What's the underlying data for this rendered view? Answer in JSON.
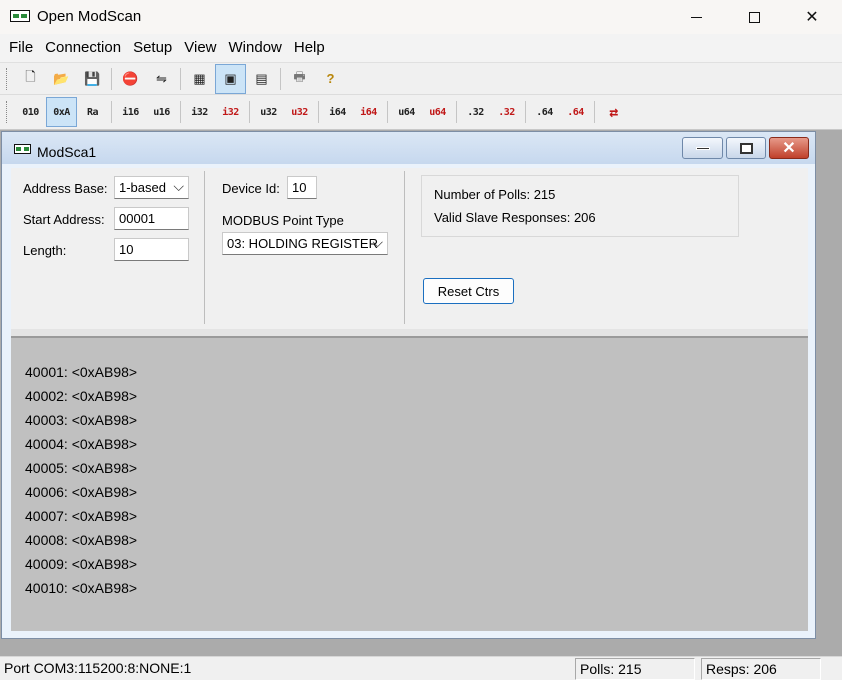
{
  "window": {
    "title": "Open ModScan"
  },
  "menubar": {
    "items": [
      "File",
      "Connection",
      "Setup",
      "View",
      "Window",
      "Help"
    ]
  },
  "toolbar_main": {
    "icons": [
      "new-file-icon",
      "open-folder-icon",
      "save-disk-icon",
      "disconnect-icon",
      "connect-icon",
      "data-definition-icon",
      "display-options-icon",
      "monitor-icon",
      "print-icon",
      "help-icon"
    ]
  },
  "toolbar_format": {
    "buttons": [
      {
        "label": "010",
        "red": false
      },
      {
        "label": "0xA",
        "red": false,
        "active": true
      },
      {
        "label": "Ra",
        "red": false
      },
      {
        "label": "i16",
        "red": false
      },
      {
        "label": "u16",
        "red": false
      },
      {
        "label": "i32",
        "red": false
      },
      {
        "label": "i32",
        "red": true
      },
      {
        "label": "u32",
        "red": false
      },
      {
        "label": "u32",
        "red": true
      },
      {
        "label": "i64",
        "red": false
      },
      {
        "label": "i64",
        "red": true
      },
      {
        "label": "u64",
        "red": false
      },
      {
        "label": "u64",
        "red": true
      },
      {
        "label": ".32",
        "red": false
      },
      {
        "label": ".32",
        "red": true
      },
      {
        "label": ".64",
        "red": false
      },
      {
        "label": ".64",
        "red": true
      },
      {
        "label": "⇄",
        "red": true
      }
    ]
  },
  "child": {
    "title": "ModSca1",
    "address_base_label": "Address Base:",
    "address_base_value": "1-based",
    "start_address_label": "Start Address:",
    "start_address_value": "00001",
    "length_label": "Length:",
    "length_value": "10",
    "device_id_label": "Device Id:",
    "device_id_value": "10",
    "point_type_label": "MODBUS Point Type",
    "point_type_value": "03: HOLDING REGISTER",
    "polls_text": "Number of Polls: 215",
    "responses_text": "Valid Slave Responses: 206",
    "reset_button": "Reset Ctrs",
    "rows": [
      "40001: <0xAB98>",
      "40002: <0xAB98>",
      "40003: <0xAB98>",
      "40004: <0xAB98>",
      "40005: <0xAB98>",
      "40006: <0xAB98>",
      "40007: <0xAB98>",
      "40008: <0xAB98>",
      "40009: <0xAB98>",
      "40010: <0xAB98>"
    ]
  },
  "statusbar": {
    "port": "Port COM3:115200:8:NONE:1",
    "polls": "Polls: 215",
    "resps": "Resps: 206"
  }
}
